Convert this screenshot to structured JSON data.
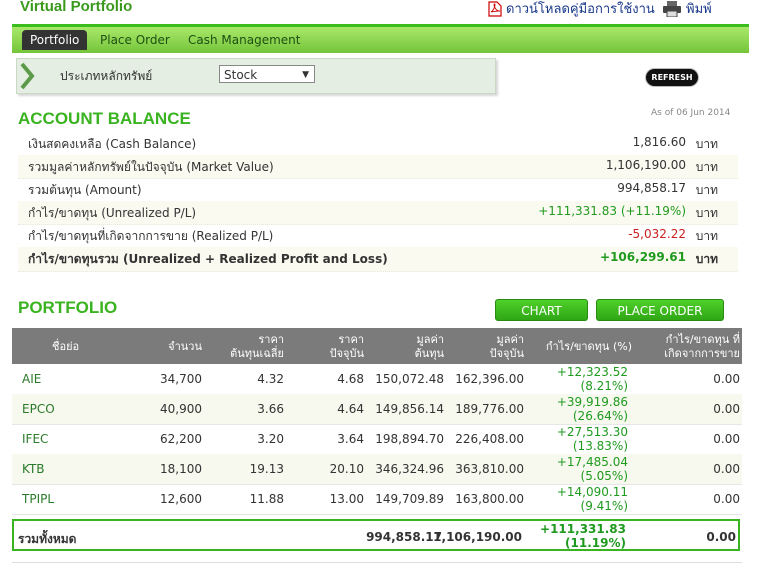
{
  "header": {
    "app_title": "Virtual Portfolio",
    "manual_link": "ดาวน์โหลดคู่มือการใช้งาน",
    "print_link": "พิมพ์"
  },
  "nav": {
    "tabs": [
      {
        "label": "Portfolio",
        "active": true
      },
      {
        "label": "Place Order",
        "active": false
      },
      {
        "label": "Cash Management",
        "active": false
      }
    ]
  },
  "filter": {
    "label": "ประเภทหลักทรัพย์",
    "selected": "Stock"
  },
  "refresh_label": "REFRESH",
  "account": {
    "title": "ACCOUNT BALANCE",
    "as_of": "As of 06 Jun 2014",
    "unit": "บาท",
    "rows": [
      {
        "label": "เงินสดคงเหลือ (Cash Balance)",
        "value": "1,816.60"
      },
      {
        "label": "รวมมูลค่าหลักทรัพย์ในปัจจุบัน (Market Value)",
        "value": "1,106,190.00"
      },
      {
        "label": "รวมต้นทุน (Amount)",
        "value": "994,858.17"
      },
      {
        "label": "กำไร/ขาดทุน (Unrealized P/L)",
        "value": "+111,331.83 (+11.19%)"
      },
      {
        "label": "กำไร/ขาดทุนที่เกิดจากการขาย (Realized P/L)",
        "value": "-5,032.22"
      },
      {
        "label": "กำไร/ขาดทุนรวม (Unrealized + Realized Profit and Loss)",
        "value": "+106,299.61"
      }
    ]
  },
  "portfolio": {
    "title": "PORTFOLIO",
    "chart_button": "CHART",
    "place_order_button": "PLACE ORDER",
    "headers": {
      "symbol": "ชื่อย่อ",
      "volume": "จำนวน",
      "avg_cost_1": "ราคา",
      "avg_cost_2": "ต้นทุนเฉลี่ย",
      "price_1": "ราคา",
      "price_2": "ปัจจุบัน",
      "cost_value_1": "มูลค่า",
      "cost_value_2": "ต้นทุน",
      "market_value_1": "มูลค่า",
      "market_value_2": "ปัจจุบัน",
      "pl_pct": "กำไร/ขาดทุน (%)",
      "realized_1": "กำไร/ขาดทุน ที่",
      "realized_2": "เกิดจากการขาย"
    },
    "rows": [
      {
        "symbol": "AIE",
        "volume": "34,700",
        "avg_cost": "4.32",
        "price": "4.68",
        "cost_value": "150,072.48",
        "market_value": "162,396.00",
        "pl": "+12,323.52",
        "pl_pct": "(8.21%)",
        "realized": "0.00"
      },
      {
        "symbol": "EPCO",
        "volume": "40,900",
        "avg_cost": "3.66",
        "price": "4.64",
        "cost_value": "149,856.14",
        "market_value": "189,776.00",
        "pl": "+39,919.86",
        "pl_pct": "(26.64%)",
        "realized": "0.00"
      },
      {
        "symbol": "IFEC",
        "volume": "62,200",
        "avg_cost": "3.20",
        "price": "3.64",
        "cost_value": "198,894.70",
        "market_value": "226,408.00",
        "pl": "+27,513.30",
        "pl_pct": "(13.83%)",
        "realized": "0.00"
      },
      {
        "symbol": "KTB",
        "volume": "18,100",
        "avg_cost": "19.13",
        "price": "20.10",
        "cost_value": "346,324.96",
        "market_value": "363,810.00",
        "pl": "+17,485.04",
        "pl_pct": "(5.05%)",
        "realized": "0.00"
      },
      {
        "symbol": "TPIPL",
        "volume": "12,600",
        "avg_cost": "11.88",
        "price": "13.00",
        "cost_value": "149,709.89",
        "market_value": "163,800.00",
        "pl": "+14,090.11",
        "pl_pct": "(9.41%)",
        "realized": "0.00"
      }
    ],
    "total": {
      "label": "รวมทั้งหมด",
      "cost_value": "994,858.17",
      "market_value": "1,106,190.00",
      "pl": "+111,331.83",
      "pl_pct": "(11.19%)",
      "realized": "0.00"
    }
  }
}
